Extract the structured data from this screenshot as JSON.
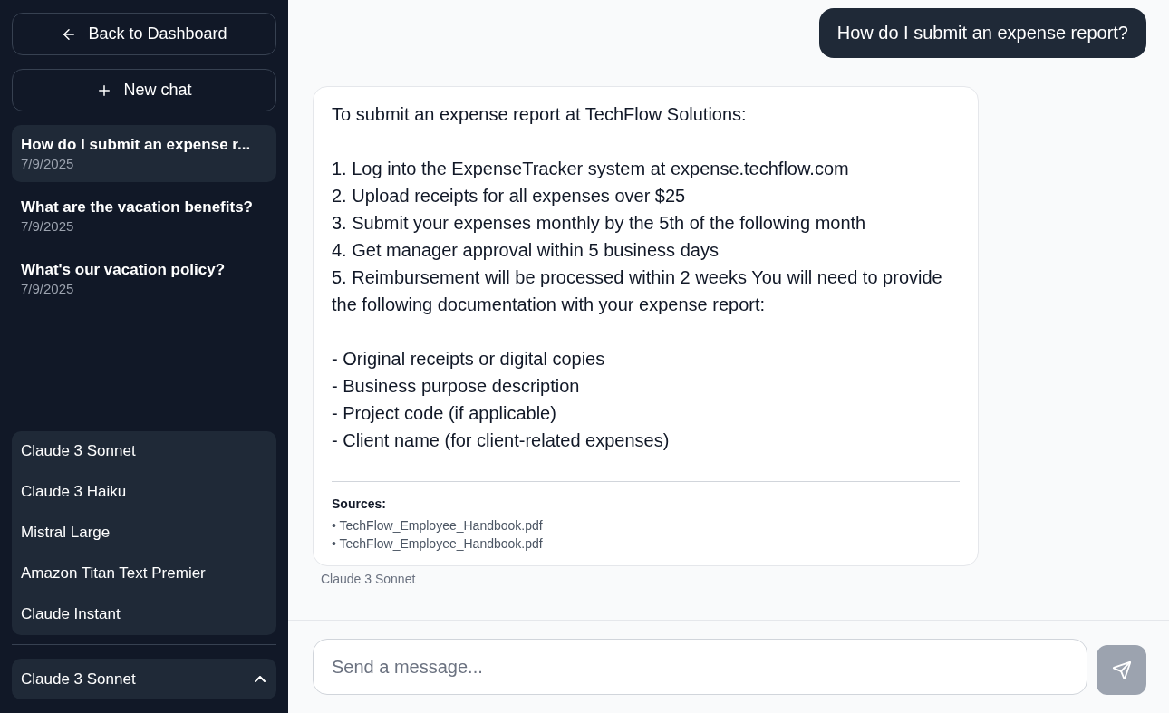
{
  "sidebar": {
    "back_button": {
      "label": "Back to Dashboard"
    },
    "new_chat_button": {
      "label": "New chat"
    },
    "chats": [
      {
        "title": "How do I submit an expense r...",
        "date": "7/9/2025",
        "selected": true
      },
      {
        "title": "What are the vacation benefits?",
        "date": "7/9/2025",
        "selected": false
      },
      {
        "title": "What's our vacation policy?",
        "date": "7/9/2025",
        "selected": false
      }
    ],
    "model_menu": {
      "options": [
        "Claude 3 Sonnet",
        "Claude 3 Haiku",
        "Mistral Large",
        "Amazon Titan Text Premier",
        "Claude Instant"
      ]
    },
    "model_select": {
      "value": "Claude 3 Sonnet",
      "expanded": true
    }
  },
  "messages": [
    {
      "kind": "user",
      "paragraphs": [
        [
          "How do I submit an expense report?"
        ]
      ]
    },
    {
      "kind": "assistant",
      "paragraphs": [
        [
          "To submit an expense report at TechFlow Solutions:"
        ],
        [
          "1. Log into the ExpenseTracker system at expense.techflow.com",
          "2. Upload receipts for all expenses over $25",
          "3. Submit your expenses monthly by the 5th of the following month",
          "4. Get manager approval within 5 business days",
          "5. Reimbursement will be processed within 2 weeks You will need to provide the following documentation with your expense report:"
        ],
        [
          "- Original receipts or digital copies",
          "- Business purpose description",
          "- Project code (if applicable)",
          "- Client name (for client-related expenses)"
        ]
      ],
      "sources_title": "Sources:",
      "sources": [
        "• TechFlow_Employee_Handbook.pdf",
        "• TechFlow_Employee_Handbook.pdf"
      ],
      "model": "Claude 3 Sonnet"
    }
  ],
  "composer": {
    "placeholder": "Send a message...",
    "send_disabled": true
  }
}
